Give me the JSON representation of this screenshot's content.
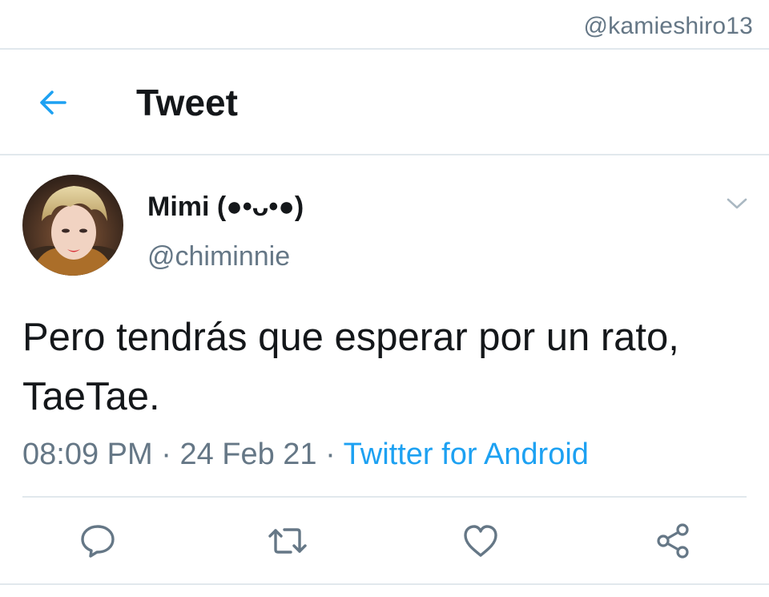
{
  "watermark": "@kamieshiro13",
  "header": {
    "title": "Tweet",
    "back_icon": "arrow-left-icon"
  },
  "tweet": {
    "author": {
      "display_name": "Mimi (●•ᴗ•●)",
      "handle": "@chiminnie",
      "avatar": "profile-photo"
    },
    "text": "Pero tendrás que esperar por un rato, TaeTae.",
    "time": "08:09 PM",
    "separator": "·",
    "date": "24 Feb 21",
    "source": "Twitter for Android"
  },
  "actions": [
    {
      "name": "reply",
      "icon": "comment-icon"
    },
    {
      "name": "retweet",
      "icon": "retweet-icon"
    },
    {
      "name": "like",
      "icon": "heart-icon"
    },
    {
      "name": "share",
      "icon": "share-icon"
    }
  ],
  "colors": {
    "accent": "#1da1f2",
    "text": "#14171a",
    "muted": "#657786",
    "divider": "#e1e8ed"
  }
}
